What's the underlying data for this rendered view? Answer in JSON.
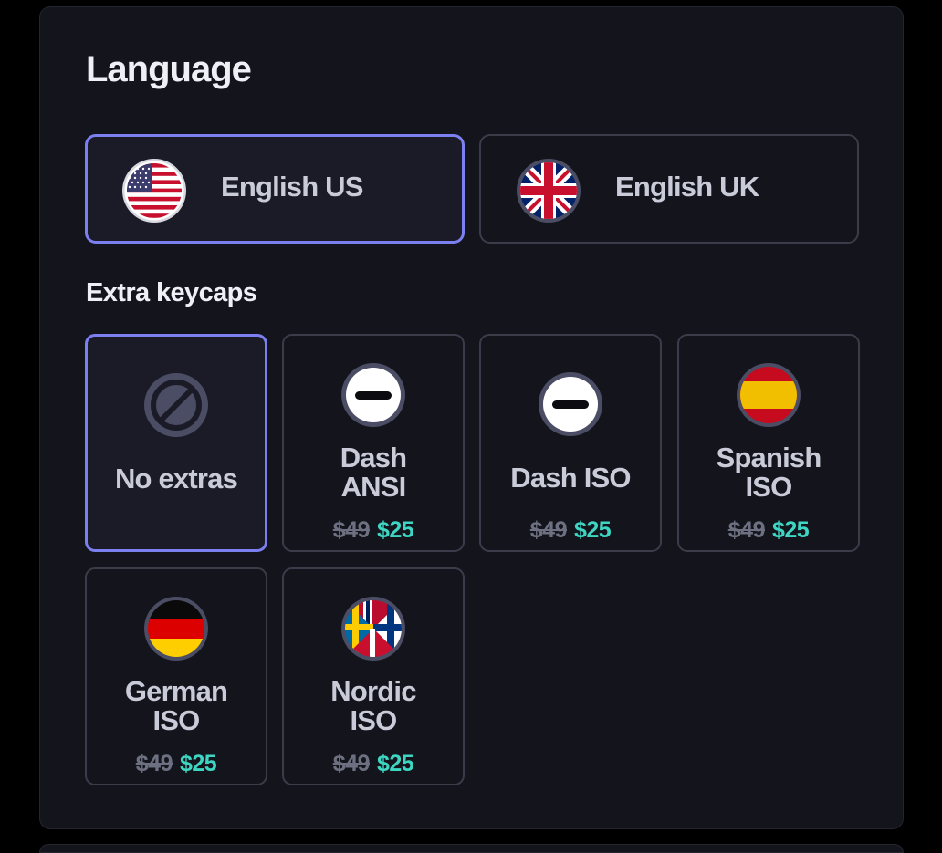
{
  "language": {
    "title": "Language",
    "options": [
      {
        "label": "English US",
        "flag": "us-flag-icon",
        "selected": true
      },
      {
        "label": "English UK",
        "flag": "uk-flag-icon",
        "selected": false
      }
    ]
  },
  "extras": {
    "title": "Extra keycaps",
    "options": [
      {
        "name_line1": "No extras",
        "icon": "prohibited-icon",
        "selected": true
      },
      {
        "name_line1": "Dash",
        "name_line2": "ANSI",
        "icon": "dash-icon",
        "old_price": "$49",
        "new_price": "$25"
      },
      {
        "name_line1": "Dash ISO",
        "icon": "dash-icon",
        "old_price": "$49",
        "new_price": "$25"
      },
      {
        "name_line1": "Spanish",
        "name_line2": "ISO",
        "icon": "spain-flag-icon",
        "old_price": "$49",
        "new_price": "$25"
      },
      {
        "name_line1": "German",
        "name_line2": "ISO",
        "icon": "germany-flag-icon",
        "old_price": "$49",
        "new_price": "$25"
      },
      {
        "name_line1": "Nordic",
        "name_line2": "ISO",
        "icon": "nordic-flags-icon",
        "old_price": "$49",
        "new_price": "$25"
      }
    ]
  },
  "colors": {
    "accent_border": "#7b7ff0",
    "discount_price": "#3ed6c2",
    "panel_bg": "#13141c"
  }
}
